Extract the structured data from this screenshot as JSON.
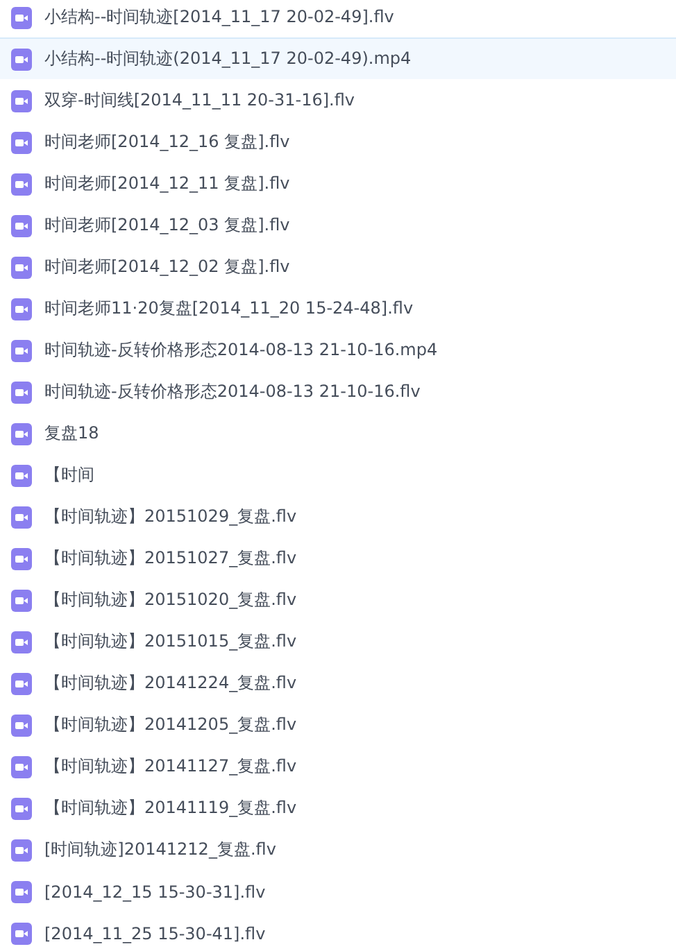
{
  "files": [
    {
      "name": "小结构--时间轨迹[2014_11_17 20-02-49].flv",
      "selected": false
    },
    {
      "name": "小结构--时间轨迹(2014_11_17 20-02-49).mp4",
      "selected": true
    },
    {
      "name": "双穿-时间线[2014_11_11 20-31-16].flv",
      "selected": false
    },
    {
      "name": "时间老师[2014_12_16 复盘].flv",
      "selected": false
    },
    {
      "name": "时间老师[2014_12_11 复盘].flv",
      "selected": false
    },
    {
      "name": "时间老师[2014_12_03 复盘].flv",
      "selected": false
    },
    {
      "name": "时间老师[2014_12_02 复盘].flv",
      "selected": false
    },
    {
      "name": "时间老师11·20复盘[2014_11_20 15-24-48].flv",
      "selected": false
    },
    {
      "name": "时间轨迹-反转价格形态2014-08-13 21-10-16.mp4",
      "selected": false
    },
    {
      "name": "时间轨迹-反转价格形态2014-08-13 21-10-16.flv",
      "selected": false
    },
    {
      "name": "复盘18",
      "selected": false
    },
    {
      "name": "【时间",
      "selected": false
    },
    {
      "name": "【时间轨迹】20151029_复盘.flv",
      "selected": false
    },
    {
      "name": "【时间轨迹】20151027_复盘.flv",
      "selected": false
    },
    {
      "name": "【时间轨迹】20151020_复盘.flv",
      "selected": false
    },
    {
      "name": "【时间轨迹】20151015_复盘.flv",
      "selected": false
    },
    {
      "name": "【时间轨迹】20141224_复盘.flv",
      "selected": false
    },
    {
      "name": "【时间轨迹】20141205_复盘.flv",
      "selected": false
    },
    {
      "name": "【时间轨迹】20141127_复盘.flv",
      "selected": false
    },
    {
      "name": "【时间轨迹】20141119_复盘.flv",
      "selected": false
    },
    {
      "name": "[时间轨迹]20141212_复盘.flv",
      "selected": false
    },
    {
      "name": "[2014_12_15 15-30-31].flv",
      "selected": false
    },
    {
      "name": "[2014_11_25 15-30-41].flv",
      "selected": false
    }
  ]
}
